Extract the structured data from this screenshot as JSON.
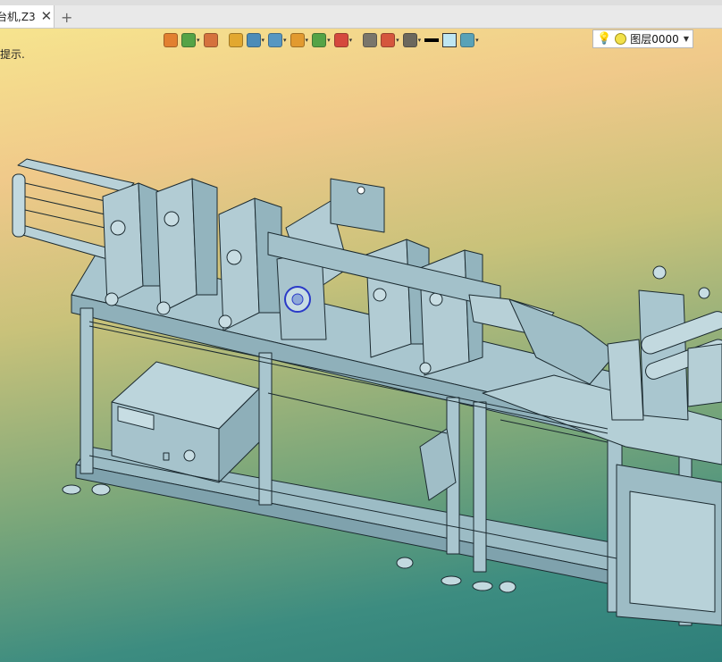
{
  "tab": {
    "label": "台机,Z3",
    "close_glyph": "✕",
    "add_glyph": "+"
  },
  "viewport": {
    "hint": "提示.",
    "background_top": "#f6e48e",
    "background_bottom": "#2e7f7a"
  },
  "toolbar": {
    "items": [
      {
        "name": "exit-icon",
        "color": "#e07020"
      },
      {
        "name": "layer-manager-icon",
        "color": "#3a9a3a"
      },
      {
        "name": "pencil-icon",
        "color": "#d06030"
      },
      {
        "name": "solid-box-icon",
        "color": "#e0a020"
      },
      {
        "name": "cube-icon",
        "color": "#2f7fc0"
      },
      {
        "name": "view-cube-icon",
        "color": "#3c8ccc"
      },
      {
        "name": "render-icon",
        "color": "#e09020"
      },
      {
        "name": "zoom-fit-icon",
        "color": "#3a9a3a"
      },
      {
        "name": "target-icon",
        "color": "#d03030"
      },
      {
        "name": "frame-icon",
        "color": "#666666"
      },
      {
        "name": "dimension-icon",
        "color": "#d04030"
      },
      {
        "name": "display-icon",
        "color": "#555555"
      },
      {
        "name": "line-color-icon",
        "color": "#000000"
      },
      {
        "name": "fill-color-icon",
        "color": "#bfe6f2"
      },
      {
        "name": "layers-stack-icon",
        "color": "#3f9ac0"
      }
    ],
    "layer": {
      "label": "图层0000",
      "bulb_icon": "bulb-icon",
      "state_color": "#f2e14a"
    }
  },
  "model": {
    "body_color": "#a9c6cf",
    "edge_color": "#1b2a30",
    "highlight_color": "#2a3ac8"
  }
}
